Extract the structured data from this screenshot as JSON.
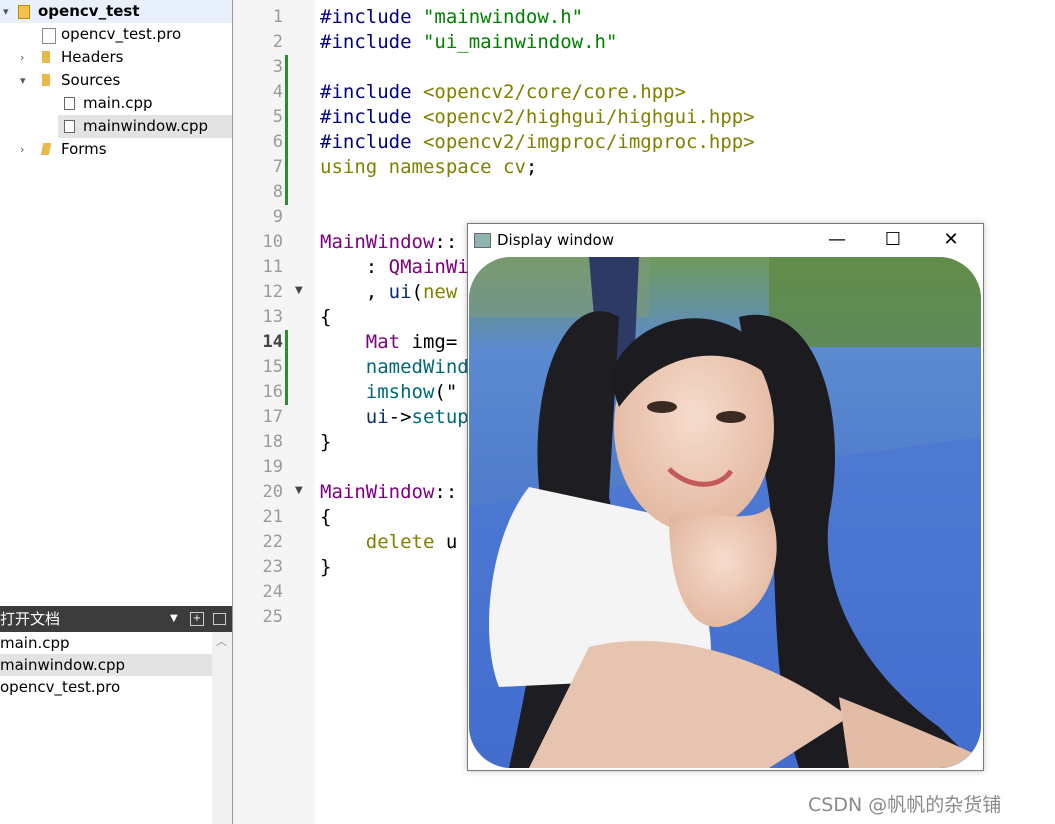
{
  "project_tree": {
    "root": "opencv_test",
    "items": [
      {
        "label": "opencv_test.pro",
        "icon": "pro-file-icon"
      },
      {
        "label": "Headers",
        "icon": "folder-icon"
      },
      {
        "label": "Sources",
        "icon": "folder-icon"
      },
      {
        "label": "main.cpp",
        "icon": "cpp-file-icon"
      },
      {
        "label": "mainwindow.cpp",
        "icon": "cpp-file-icon"
      },
      {
        "label": "Forms",
        "icon": "folder-icon"
      }
    ]
  },
  "open_documents": {
    "title": "打开文档",
    "items": [
      "main.cpp",
      "mainwindow.cpp",
      "opencv_test.pro"
    ]
  },
  "editor": {
    "line_numbers": [
      "1",
      "2",
      "3",
      "4",
      "5",
      "6",
      "7",
      "8",
      "9",
      "10",
      "11",
      "12",
      "13",
      "14",
      "15",
      "16",
      "17",
      "18",
      "19",
      "20",
      "21",
      "22",
      "23",
      "24",
      "25"
    ],
    "current_line": "14",
    "lines": {
      "l1a": "#include ",
      "l1b": "\"mainwindow.h\"",
      "l2a": "#include ",
      "l2b": "\"ui_mainwindow.h\"",
      "l4a": "#include ",
      "l4b": "<opencv2/core/core.hpp>",
      "l5a": "#include ",
      "l5b": "<opencv2/highgui/highgui.hpp>",
      "l6a": "#include ",
      "l6b": "<opencv2/imgproc/imgproc.hpp>",
      "l7a": "using namespace ",
      "l7b": "cv",
      "l7c": ";",
      "l10a": "MainWindow",
      "l10b": "::",
      "l11a": "    : ",
      "l11b": "QMainWi",
      "l12a": "    , ",
      "l12b": "ui",
      "l12c": "(",
      "l12d": "new",
      "l13": "{",
      "l14a": "    ",
      "l14b": "Mat",
      "l14c": " img=",
      "l15a": "    ",
      "l15b": "namedWind",
      "l16a": "    ",
      "l16b": "imshow",
      "l16c": "(\"",
      "l17a": "    ",
      "l17b": "ui",
      "l17c": "->",
      "l17d": "setup",
      "l18": "}",
      "l20a": "MainWindow",
      "l20b": "::",
      "l21": "{",
      "l22a": "    ",
      "l22b": "delete",
      "l22c": " u",
      "l23": "}"
    }
  },
  "display_window": {
    "title": "Display window",
    "minimize": "—",
    "maximize": "☐",
    "close": "✕"
  },
  "watermark": "CSDN @帆帆的杂货铺",
  "colors": {
    "preprocessor": "#000080",
    "string": "#008000",
    "keyword": "#808000",
    "class": "#800080",
    "modified_line_marker": "#2e8b2e"
  }
}
